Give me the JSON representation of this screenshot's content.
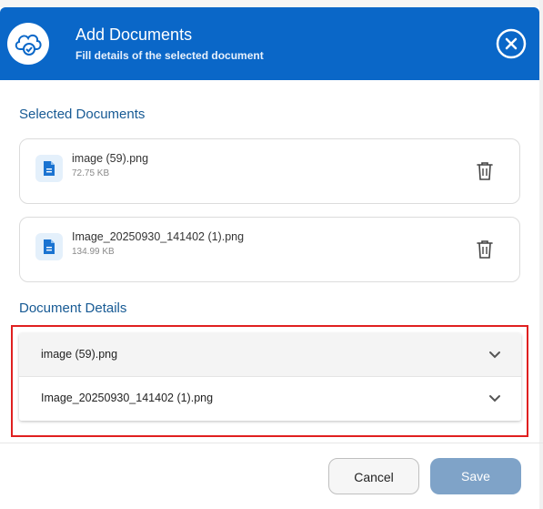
{
  "header": {
    "icon": "cloud-check-icon",
    "title": "Add Documents",
    "subtitle": "Fill details of the selected document",
    "close_icon": "close-circle-icon"
  },
  "selected_documents": {
    "title": "Selected Documents",
    "files": [
      {
        "name": "image (59).png",
        "size": "72.75 KB",
        "icon": "document-icon",
        "delete_icon": "trash-icon"
      },
      {
        "name": "Image_20250930_141402 (1).png",
        "size": "134.99 KB",
        "icon": "document-icon",
        "delete_icon": "trash-icon"
      }
    ]
  },
  "document_details": {
    "title": "Document Details",
    "items": [
      {
        "label": "image (59).png",
        "icon": "chevron-down-icon"
      },
      {
        "label": "Image_20250930_141402 (1).png",
        "icon": "chevron-down-icon"
      }
    ]
  },
  "footer": {
    "cancel_label": "Cancel",
    "save_label": "Save"
  },
  "colors": {
    "header_bg": "#0a67c8",
    "section_title": "#175a94",
    "save_bg": "#7fa3c8",
    "annotation": "#e02020"
  }
}
